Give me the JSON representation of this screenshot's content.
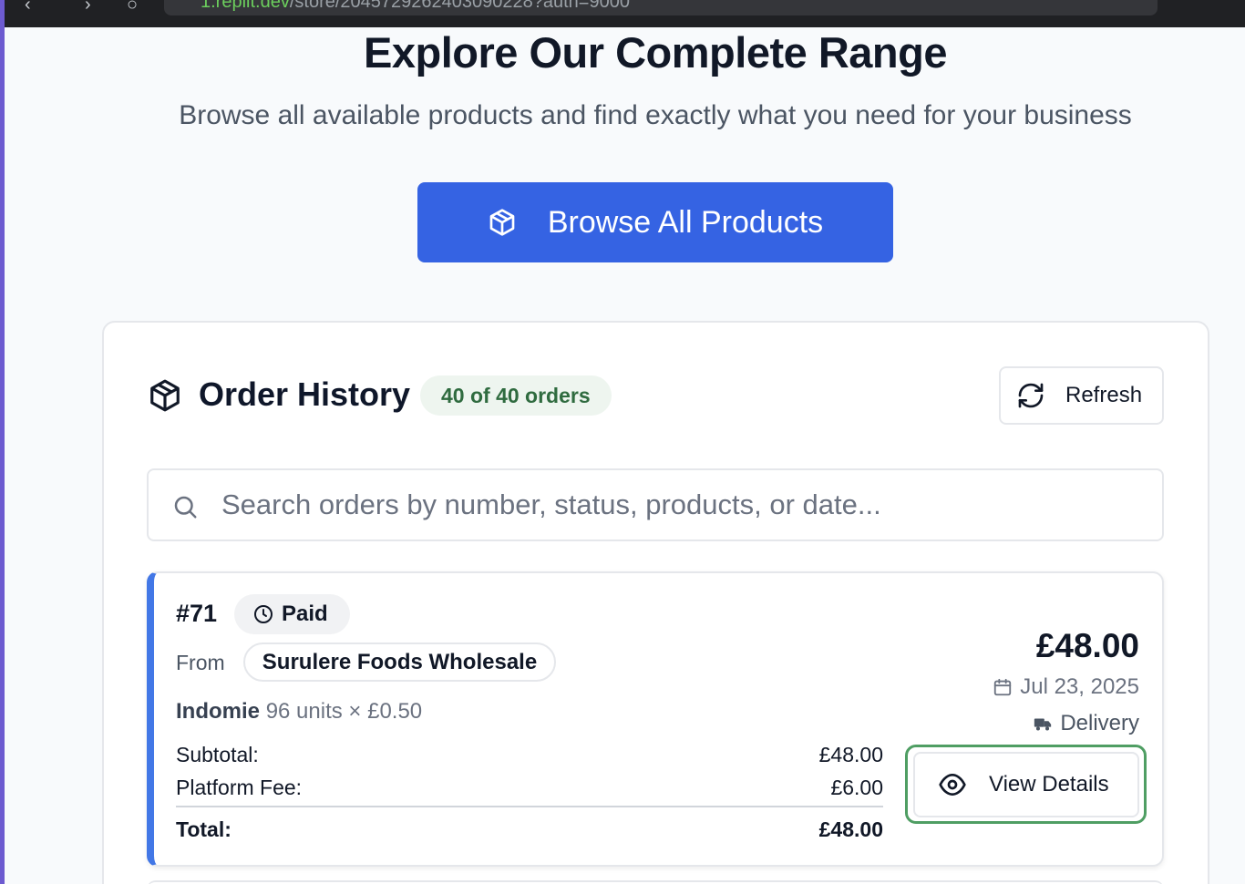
{
  "browser": {
    "url_host": "1.replit.dev",
    "url_path": "/store/2045729262403090228?auth=9000"
  },
  "hero": {
    "title": "Explore Our Complete Range",
    "subtitle": "Browse all available products and find exactly what you need for your business",
    "browse_button": {
      "label": "Browse All Products",
      "icon": "package-icon"
    }
  },
  "order_history": {
    "title": "Order History",
    "count_badge": "40 of 40 orders",
    "refresh_label": "Refresh",
    "search": {
      "placeholder": "Search orders by number, status, products, or date...",
      "value": ""
    },
    "orders": [
      {
        "number": "#71",
        "status": "Paid",
        "from_label": "From",
        "vendor": "Surulere Foods Wholesale",
        "item_name": "Indomie",
        "item_detail": "96 units × £0.50",
        "subtotal_label": "Subtotal:",
        "subtotal": "£48.00",
        "fee_label": "Platform Fee:",
        "fee": "£6.00",
        "total_label": "Total:",
        "total": "£48.00",
        "price": "£48.00",
        "date": "Jul 23, 2025",
        "fulfilment": "Delivery",
        "view_label": "View Details"
      }
    ]
  },
  "colors": {
    "primary": "#3563e3",
    "card_accent": "#4277e6",
    "badge_bg": "#eef5ef",
    "badge_text": "#2f6b3f",
    "focus_ring": "#4f9e63"
  }
}
